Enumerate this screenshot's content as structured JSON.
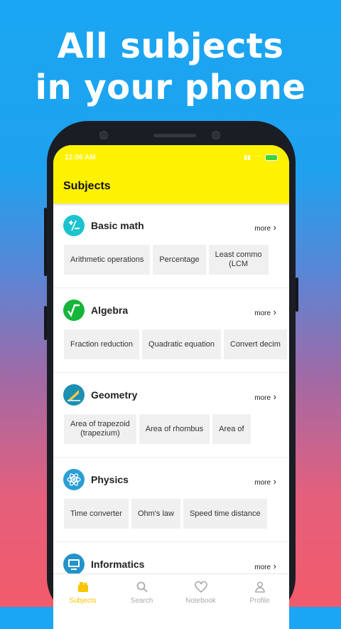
{
  "headline": {
    "line1": "All subjects",
    "line2": "in your phone"
  },
  "status_bar": {
    "time": "12:06 AM"
  },
  "app_bar": {
    "title": "Subjects"
  },
  "sections": [
    {
      "title": "Basic math",
      "more": "more",
      "icon": "plus-minus-icon",
      "color": "#1cc3cf",
      "chips": [
        "Arithmetic operations",
        "Percentage",
        "Least commo\n(LCM"
      ]
    },
    {
      "title": "Algebra",
      "more": "more",
      "icon": "square-root-icon",
      "color": "#16b53a",
      "chips": [
        "Fraction reduction",
        "Quadratic equation",
        "Convert decim"
      ]
    },
    {
      "title": "Geometry",
      "more": "more",
      "icon": "triangle-ruler-icon",
      "color": "#1c8fb2",
      "chips": [
        "Area of trapezoid\n(trapezium)",
        "Area of rhombus",
        "Area of"
      ]
    },
    {
      "title": "Physics",
      "more": "more",
      "icon": "atom-icon",
      "color": "#2a9ed6",
      "chips": [
        "Time converter",
        "Ohm's law",
        "Speed time distance"
      ]
    },
    {
      "title": "Informatics",
      "more": "more",
      "icon": "computer-icon",
      "color": "#2393c9",
      "chips": []
    }
  ],
  "bottom_nav": [
    {
      "label": "Subjects",
      "icon": "books-icon",
      "active": true
    },
    {
      "label": "Search",
      "icon": "search-icon",
      "active": false
    },
    {
      "label": "Notebook",
      "icon": "heart-icon",
      "active": false
    },
    {
      "label": "Profile",
      "icon": "person-icon",
      "active": false
    }
  ],
  "colors": {
    "accent": "#fff200",
    "active_nav": "#f7c600"
  }
}
